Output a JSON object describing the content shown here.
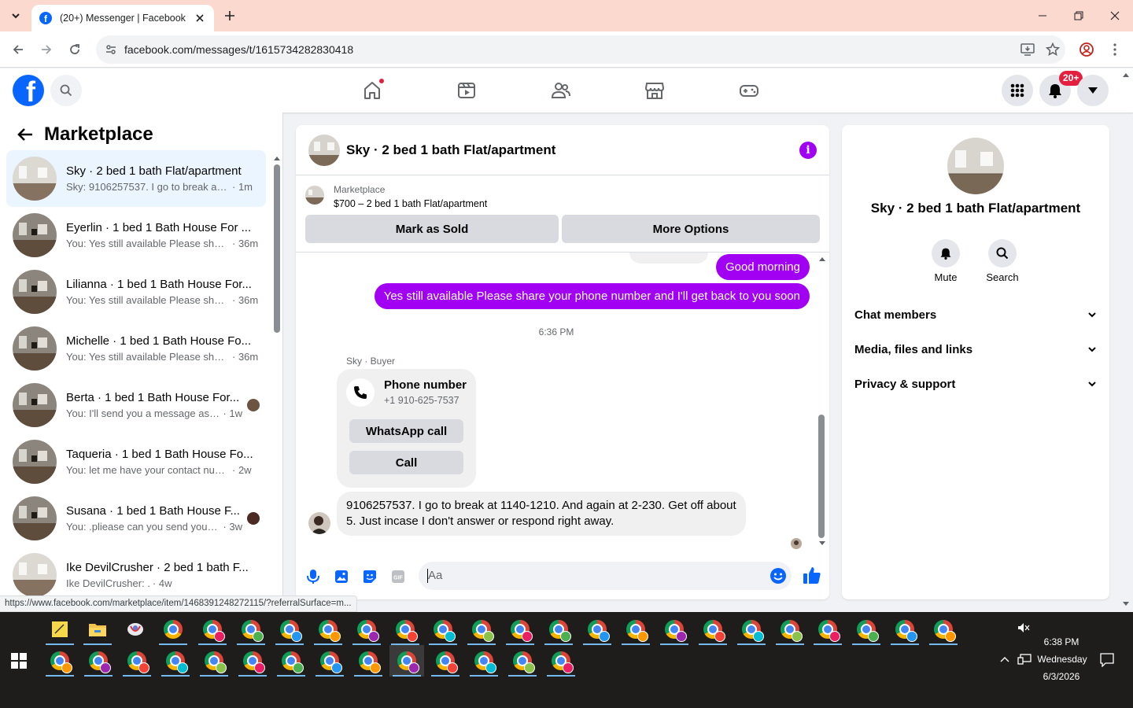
{
  "browser": {
    "tab_title": "(20+) Messenger | Facebook",
    "url": "facebook.com/messages/t/1615734282830418",
    "status_url": "https://www.facebook.com/marketplace/item/1468391248272115/?referralSurface=m..."
  },
  "header": {
    "notification_badge": "20+",
    "brand_color": "#0866ff"
  },
  "left_panel": {
    "title": "Marketplace",
    "chats": [
      {
        "name": "Sky · 2 bed 1 bath Flat/apartment",
        "preview": "Sky: 9106257537. I go to break at ...",
        "time": "· 1m",
        "active": true
      },
      {
        "name": "Eyerlin · 1 bed 1 Bath House For ...",
        "preview": "You: Yes still available Please shar...",
        "time": "· 36m"
      },
      {
        "name": "Lilianna · 1 bed 1 Bath House For...",
        "preview": "You: Yes still available Please shar...",
        "time": "· 36m"
      },
      {
        "name": "Michelle · 1 bed 1 Bath House Fo...",
        "preview": "You: Yes still available Please shar...",
        "time": "· 36m"
      },
      {
        "name": "Berta · 1 bed 1 Bath House For...",
        "preview": "You: I'll send you a message as s...",
        "time": "· 1w"
      },
      {
        "name": "Taqueria · 1 bed 1 Bath House Fo...",
        "preview": "You: let me have your contact num...",
        "time": "· 2w"
      },
      {
        "name": "Susana · 1 bed 1 Bath House F...",
        "preview": "You: .pliease can you send your ...",
        "time": "· 3w"
      },
      {
        "name": "Ike DevilCrusher · 2 bed 1 bath F...",
        "preview": "Ike DevilCrusher: .",
        "time": "· 4w"
      }
    ]
  },
  "chat": {
    "title": "Sky · 2 bed 1 bath Flat/apartment",
    "marketplace_label": "Marketplace",
    "listing": "$700 – 2 bed 1 bath Flat/apartment",
    "mark_sold": "Mark as Sold",
    "more_options": "More Options",
    "msg_good_morning": "Good morning",
    "msg_still_available": "Yes still available Please share your phone number and I'll get back to you soon",
    "time_sep": "6:36 PM",
    "sender_label": "Sky · Buyer",
    "phone_title": "Phone number",
    "phone_number": "+1 910-625-7537",
    "whatsapp": "WhatsApp call",
    "call": "Call",
    "msg_incoming": "9106257537. I go to break at 1140-1210. And again at 2-230. Get off about 5. Just incase I don't answer or respond right away.",
    "composer_placeholder": "Aa",
    "accent_color": "#a100f2"
  },
  "info_panel": {
    "name": "Sky · 2 bed 1 bath Flat/apartment",
    "mute": "Mute",
    "search": "Search",
    "sections": [
      "Chat members",
      "Media, files and links",
      "Privacy & support"
    ]
  },
  "taskbar": {
    "time": "6:38 PM",
    "day": "Wednesday",
    "date": "6/3/2026"
  }
}
